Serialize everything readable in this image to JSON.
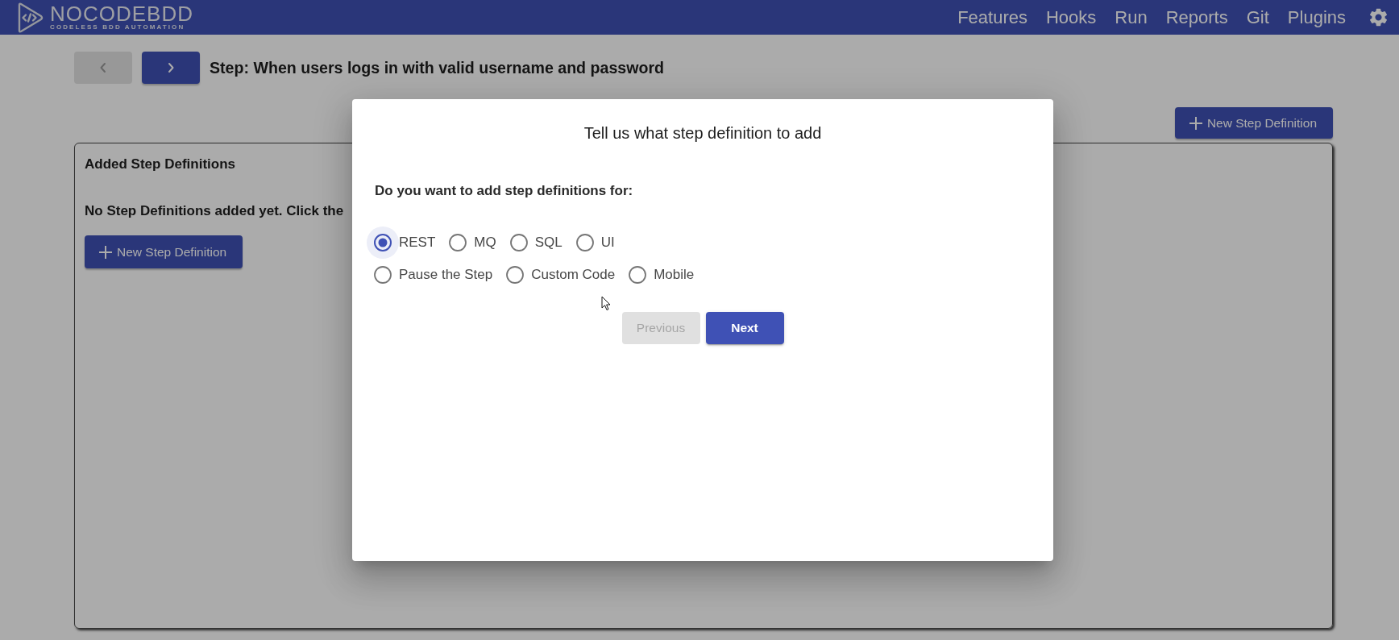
{
  "header": {
    "logo": {
      "title": "NOCODEBDD",
      "tagline": "CODELESS BDD AUTOMATION"
    },
    "nav": [
      "Features",
      "Hooks",
      "Run",
      "Reports",
      "Git",
      "Plugins"
    ]
  },
  "step_nav": {
    "previous": {
      "disabled": true
    },
    "next": {
      "disabled": false
    },
    "title": "Step: When users logs in with valid username and password"
  },
  "toolbar": {
    "new_button": "New Step Definition"
  },
  "panel": {
    "title": "Added Step Definitions",
    "message": "No Step Definitions added yet. Click the",
    "new_button": "New Step Definition"
  },
  "dialog": {
    "title": "Tell us what step definition to add",
    "question": "Do you want to add step definitions for:",
    "option_rows": [
      [
        {
          "label": "REST",
          "selected": true
        },
        {
          "label": "MQ",
          "selected": false
        },
        {
          "label": "SQL",
          "selected": false
        },
        {
          "label": "UI",
          "selected": false
        }
      ],
      [
        {
          "label": "Pause the Step",
          "selected": false
        },
        {
          "label": "Custom Code",
          "selected": false
        },
        {
          "label": "Mobile",
          "selected": false
        }
      ]
    ],
    "buttons": [
      {
        "label": "Previous",
        "disabled": true
      },
      {
        "label": "Next",
        "disabled": false
      }
    ]
  }
}
